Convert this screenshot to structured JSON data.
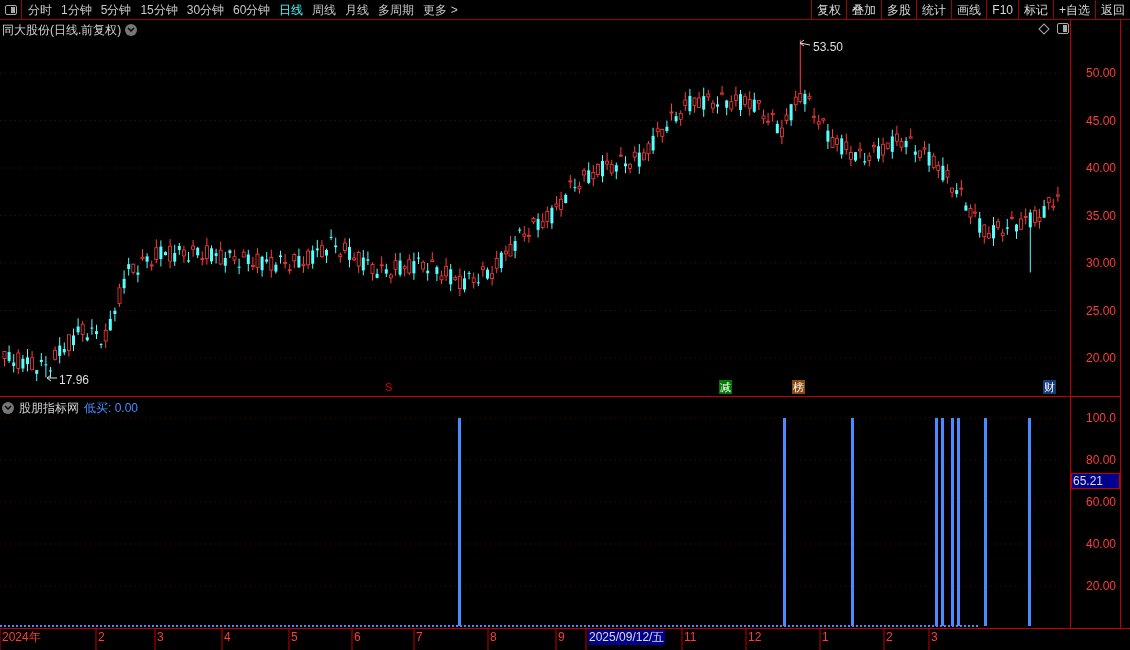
{
  "toolbar": {
    "periods": [
      {
        "label": "分时",
        "selected": false
      },
      {
        "label": "1分钟",
        "selected": false
      },
      {
        "label": "5分钟",
        "selected": false
      },
      {
        "label": "15分钟",
        "selected": false
      },
      {
        "label": "30分钟",
        "selected": false
      },
      {
        "label": "60分钟",
        "selected": false
      },
      {
        "label": "日线",
        "selected": true
      },
      {
        "label": "周线",
        "selected": false
      },
      {
        "label": "月线",
        "selected": false
      },
      {
        "label": "多周期",
        "selected": false
      },
      {
        "label": "更多 >",
        "selected": false
      }
    ],
    "buttons": [
      "复权",
      "叠加",
      "多股",
      "统计",
      "画线",
      "F10",
      "标记",
      "+自选",
      "返回"
    ]
  },
  "price_chart": {
    "title": "同大股份(日线.前复权)",
    "high_label": "53.50",
    "low_label": "17.96",
    "axis": [
      "50.00",
      "45.00",
      "40.00",
      "35.00",
      "30.00",
      "25.00",
      "20.00"
    ],
    "events": [
      {
        "label": "S",
        "color": "#e00000"
      },
      {
        "label": "减",
        "color": "#007a00"
      },
      {
        "label": "榜",
        "color": "#8a4a10"
      },
      {
        "label": "财",
        "color": "#143a78"
      }
    ]
  },
  "indicator": {
    "name": "股朋指标网",
    "reading": "低买: 0.00",
    "axis": [
      "100.0",
      "80.00",
      "60.00",
      "40.00",
      "20.00"
    ],
    "current": "65.21"
  },
  "date_axis": [
    {
      "label": "2024年",
      "selected": false
    },
    {
      "label": "2",
      "selected": false
    },
    {
      "label": "3",
      "selected": false
    },
    {
      "label": "4",
      "selected": false
    },
    {
      "label": "5",
      "selected": false
    },
    {
      "label": "6",
      "selected": false
    },
    {
      "label": "7",
      "selected": false
    },
    {
      "label": "8",
      "selected": false
    },
    {
      "label": "9",
      "selected": false
    },
    {
      "label": "2025/09/12/五",
      "selected": true
    },
    {
      "label": "11",
      "selected": false
    },
    {
      "label": "12",
      "selected": false
    },
    {
      "label": "1",
      "selected": false
    },
    {
      "label": "2",
      "selected": false
    },
    {
      "label": "3",
      "selected": false
    }
  ]
}
